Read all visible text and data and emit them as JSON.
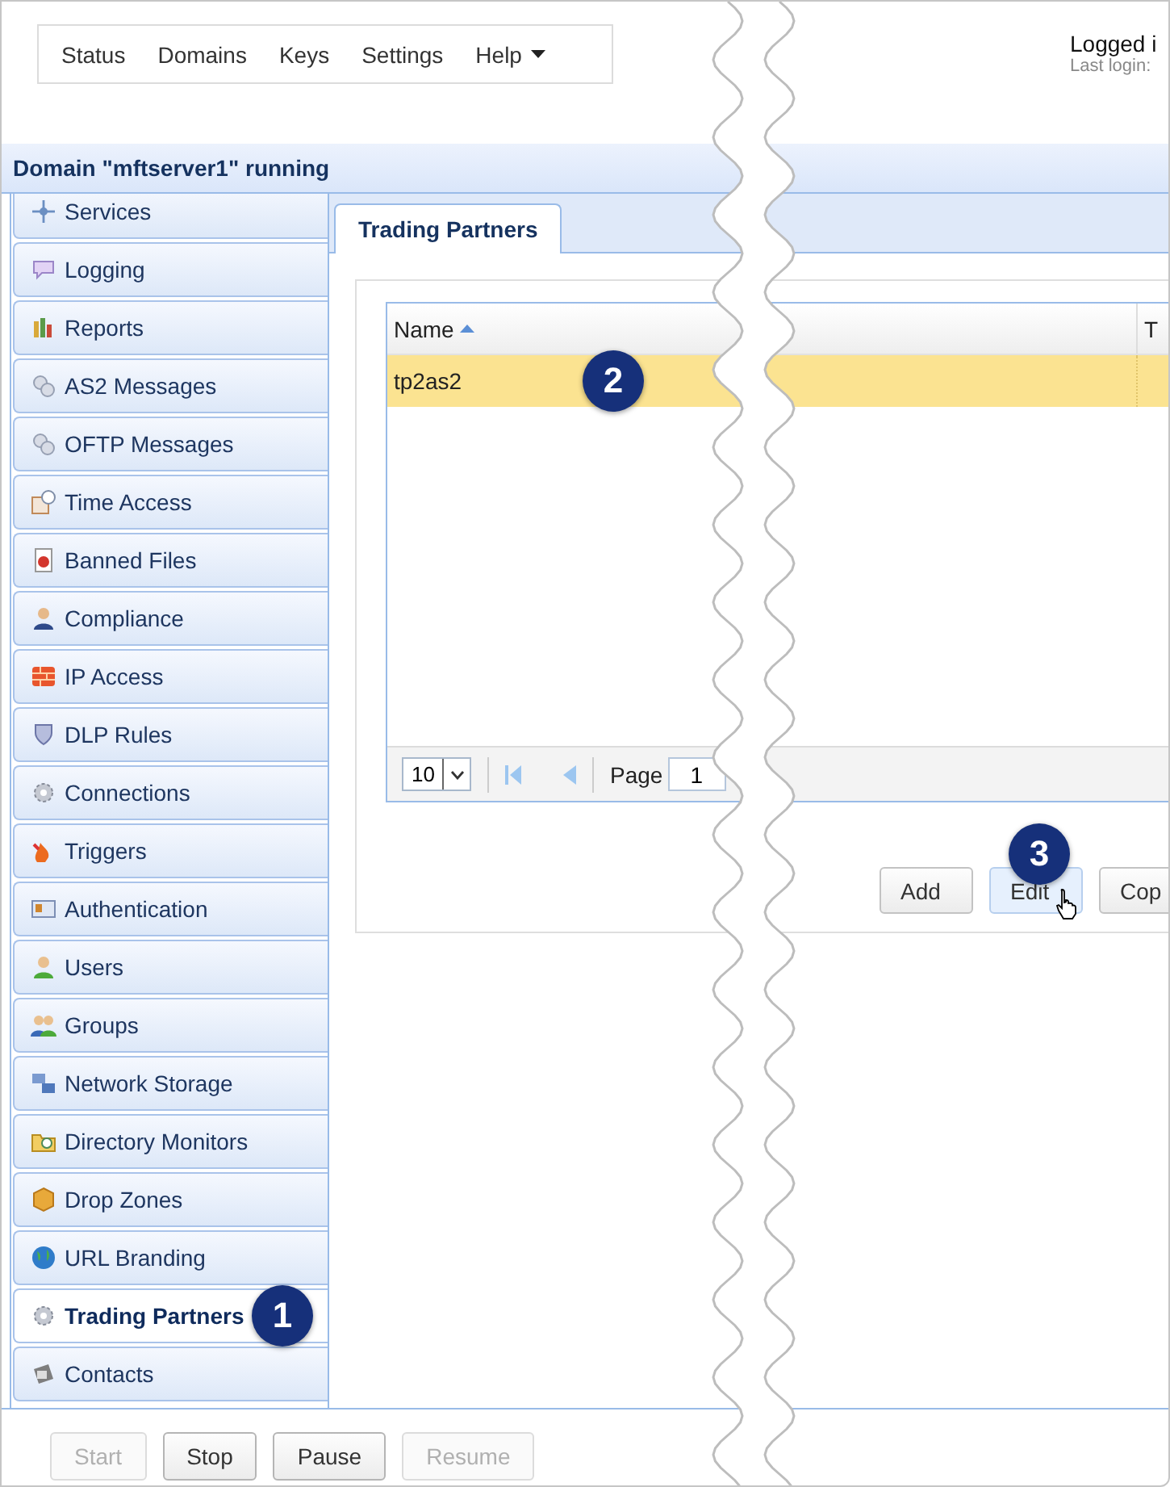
{
  "menu": [
    {
      "label": "Status",
      "dropdown": false
    },
    {
      "label": "Domains",
      "dropdown": false
    },
    {
      "label": "Keys",
      "dropdown": false
    },
    {
      "label": "Settings",
      "dropdown": false
    },
    {
      "label": "Help",
      "dropdown": true
    }
  ],
  "login": {
    "user": "Logged i",
    "last_login": "Last login:"
  },
  "domain_title": "Domain \"mftserver1\" running",
  "sidebar": {
    "items": [
      {
        "label": "Services",
        "selected": false
      },
      {
        "label": "Logging",
        "selected": false
      },
      {
        "label": "Reports",
        "selected": false
      },
      {
        "label": "AS2 Messages",
        "selected": false
      },
      {
        "label": "OFTP Messages",
        "selected": false
      },
      {
        "label": "Time Access",
        "selected": false
      },
      {
        "label": "Banned Files",
        "selected": false
      },
      {
        "label": "Compliance",
        "selected": false
      },
      {
        "label": "IP Access",
        "selected": false
      },
      {
        "label": "DLP Rules",
        "selected": false
      },
      {
        "label": "Connections",
        "selected": false
      },
      {
        "label": "Triggers",
        "selected": false
      },
      {
        "label": "Authentication",
        "selected": false
      },
      {
        "label": "Users",
        "selected": false
      },
      {
        "label": "Groups",
        "selected": false
      },
      {
        "label": "Network Storage",
        "selected": false
      },
      {
        "label": "Directory Monitors",
        "selected": false
      },
      {
        "label": "Drop Zones",
        "selected": false
      },
      {
        "label": "URL Branding",
        "selected": false
      },
      {
        "label": "Trading Partners",
        "selected": true,
        "callout": "1"
      },
      {
        "label": "Contacts",
        "selected": false
      }
    ]
  },
  "tabs": [
    {
      "label": "Trading Partners",
      "selected": true
    }
  ],
  "table": {
    "columns": [
      "Name",
      "T"
    ],
    "rows": [
      {
        "cells": [
          "tp2as2",
          ""
        ],
        "selected": true,
        "callout": "2"
      }
    ],
    "pager": {
      "page_size": "10",
      "page_label": "Page",
      "page": "1"
    }
  },
  "actions": [
    {
      "label": "Add",
      "hovered": false
    },
    {
      "label": "Edit",
      "hovered": true,
      "callout": "3"
    },
    {
      "label": "Cop",
      "hovered": false
    }
  ],
  "bottom_buttons": [
    {
      "label": "Start",
      "disabled": true
    },
    {
      "label": "Stop",
      "disabled": false
    },
    {
      "label": "Pause",
      "disabled": false
    },
    {
      "label": "Resume",
      "disabled": true
    }
  ]
}
